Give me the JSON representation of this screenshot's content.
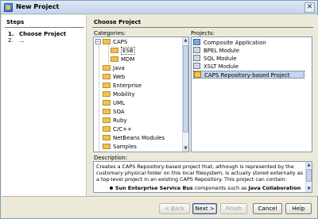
{
  "window": {
    "title": "New Project"
  },
  "steps": {
    "header": "Steps",
    "items": [
      {
        "num": "1.",
        "label": "Choose Project"
      },
      {
        "num": "2.",
        "label": "..."
      }
    ]
  },
  "content": {
    "header": "Choose Project",
    "categories_label": "Categories:",
    "projects_label": "Projects:",
    "description_label": "Description:",
    "categories": [
      {
        "label": "CAPS",
        "expanded": true
      },
      {
        "label": "ESB",
        "selected": true
      },
      {
        "label": "MDM"
      },
      {
        "label": "Java"
      },
      {
        "label": "Web"
      },
      {
        "label": "Enterprise"
      },
      {
        "label": "Mobility"
      },
      {
        "label": "UML"
      },
      {
        "label": "SOA"
      },
      {
        "label": "Ruby"
      },
      {
        "label": "C/C++"
      },
      {
        "label": "NetBeans Modules"
      },
      {
        "label": "Samples"
      }
    ],
    "projects": [
      {
        "label": "Composite Application"
      },
      {
        "label": "BPEL Module"
      },
      {
        "label": "SQL Module"
      },
      {
        "label": "XSLT Module"
      },
      {
        "label": "CAPS Repository-based Project",
        "selected": true
      }
    ],
    "description": {
      "text": "Creates a CAPS Repository-based project that, although is represented by the customary physical folder on this local filesystem, is actually stored externally as a top-level project in an existing CAPS Repository. This project can contain:",
      "bullet_prefix": "Sun Enterprise Service Bus",
      "bullet_middle": " components such as ",
      "bullet_suffix": "Java Collaboration"
    }
  },
  "buttons": {
    "back": "< Back",
    "next": "Next >",
    "finish": "Finish",
    "cancel": "Cancel",
    "help": "Help"
  }
}
